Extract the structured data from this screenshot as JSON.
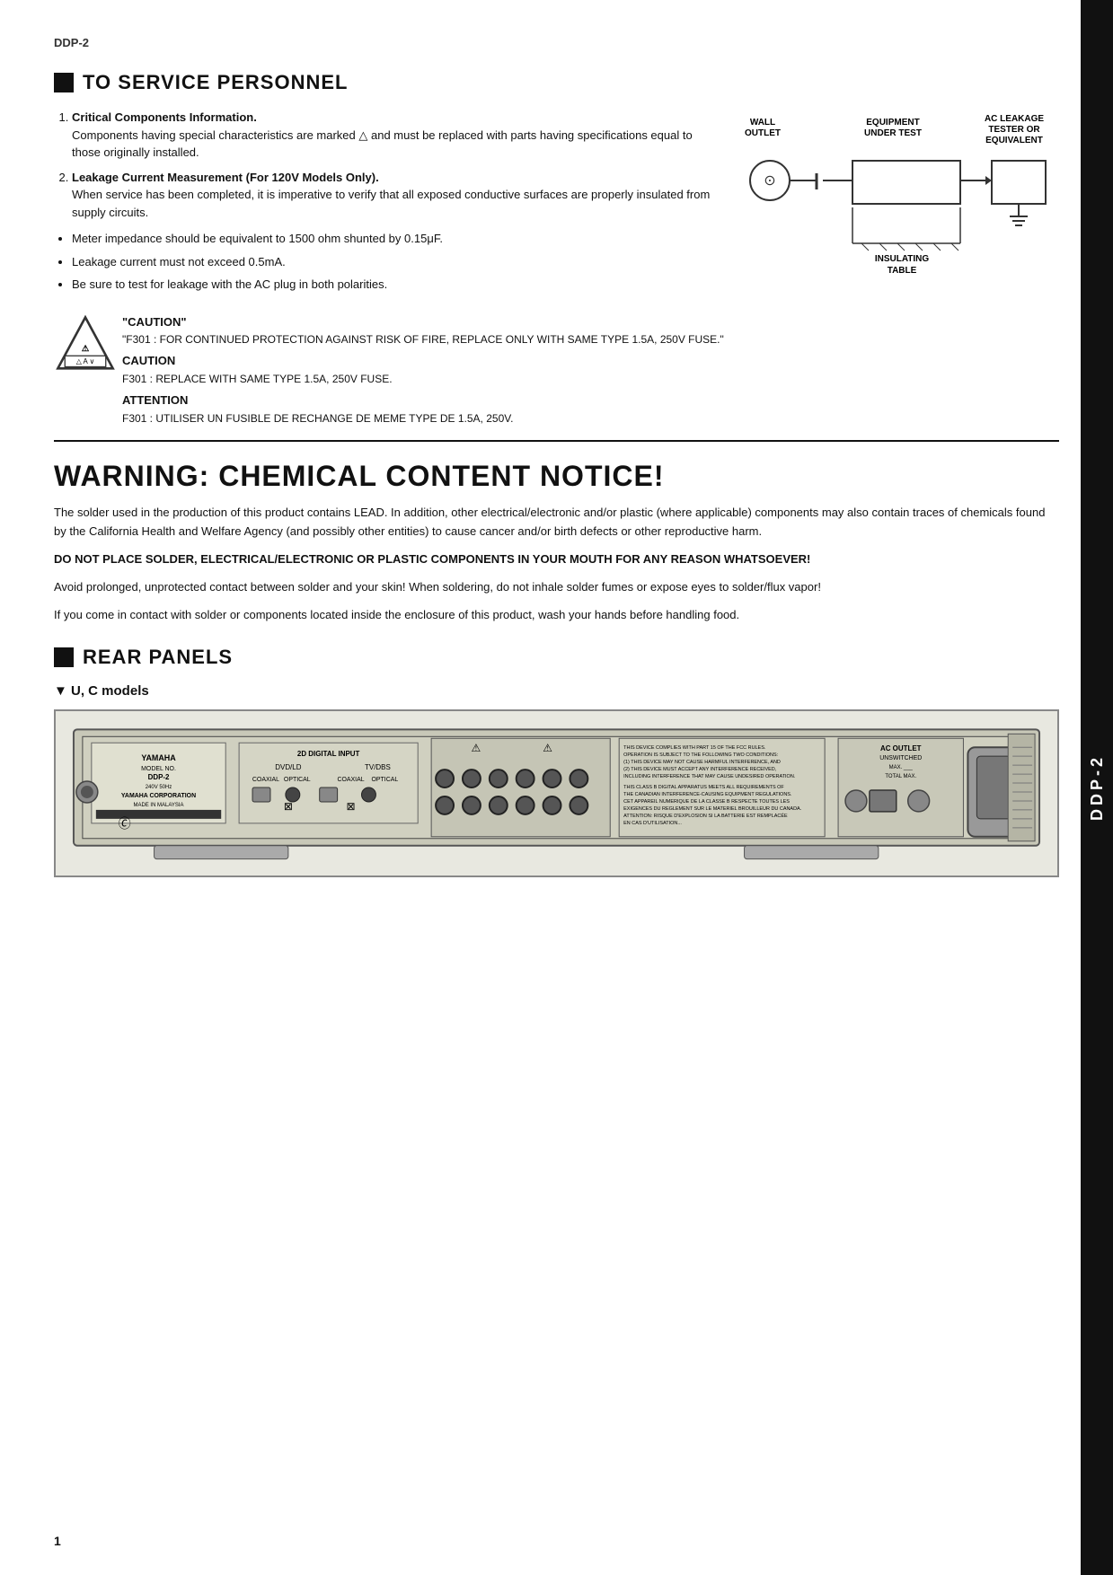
{
  "page": {
    "top_label": "DDP-2",
    "vertical_label": "DDP-2",
    "page_number": "1"
  },
  "service_section": {
    "heading": "TO SERVICE PERSONNEL",
    "items": [
      {
        "number": "1",
        "title": "Critical Components Information.",
        "body": "Components having special characteristics are marked △ and must be replaced with parts having specifications equal to those originally installed."
      },
      {
        "number": "2",
        "title": "Leakage Current Measurement (For 120V Models Only).",
        "body": "When service has been completed, it is imperative to verify that all exposed conductive surfaces are properly insulated from supply circuits."
      }
    ],
    "bullets": [
      "Meter impedance should be equivalent to 1500 ohm shunted by 0.15μF.",
      "Leakage current must not exceed 0.5mA.",
      "Be sure to test for leakage with the AC plug in both polarities."
    ]
  },
  "diagram": {
    "wall_outlet": "WALL\nOUTLET",
    "equipment_under_test": "EQUIPMENT\nUNDER TEST",
    "ac_leakage": "AC LEAKAGE\nTESTER OR\nEQUIVALENT",
    "insulating_table": "INSULATING\nTABLE"
  },
  "caution": {
    "quote_title": "\"CAUTION\"",
    "f301_caution": "\"F301 : FOR CONTINUED PROTECTION AGAINST RISK OF FIRE, REPLACE ONLY WITH SAME TYPE 1.5A, 250V FUSE.\"",
    "caution_title": "CAUTION",
    "f301_caution2": "F301   : REPLACE WITH SAME TYPE 1.5A, 250V FUSE.",
    "attention_title": "ATTENTION",
    "f301_attention": "F301   : UTILISER UN FUSIBLE DE RECHANGE DE MEME TYPE DE 1.5A, 250V."
  },
  "warning": {
    "title": "WARNING: CHEMICAL CONTENT NOTICE!",
    "para1": "The solder used in the production of this product contains LEAD. In addition, other electrical/electronic and/or plastic (where applicable) components may also contain traces of chemicals found by the California Health and Welfare Agency (and possibly other entities) to cause cancer and/or birth defects or other reproductive harm.",
    "para2": "DO NOT PLACE SOLDER, ELECTRICAL/ELECTRONIC OR PLASTIC COMPONENTS IN YOUR MOUTH FOR ANY REASON WHATSOEVER!",
    "para3": "Avoid prolonged, unprotected contact between solder and your skin! When soldering, do not inhale solder fumes or expose eyes to solder/flux vapor!",
    "para4": "If you come in contact with solder or components located inside the enclosure of this product, wash your hands before handling food."
  },
  "rear_panels": {
    "heading": "REAR PANELS",
    "model_label": "U, C models"
  }
}
